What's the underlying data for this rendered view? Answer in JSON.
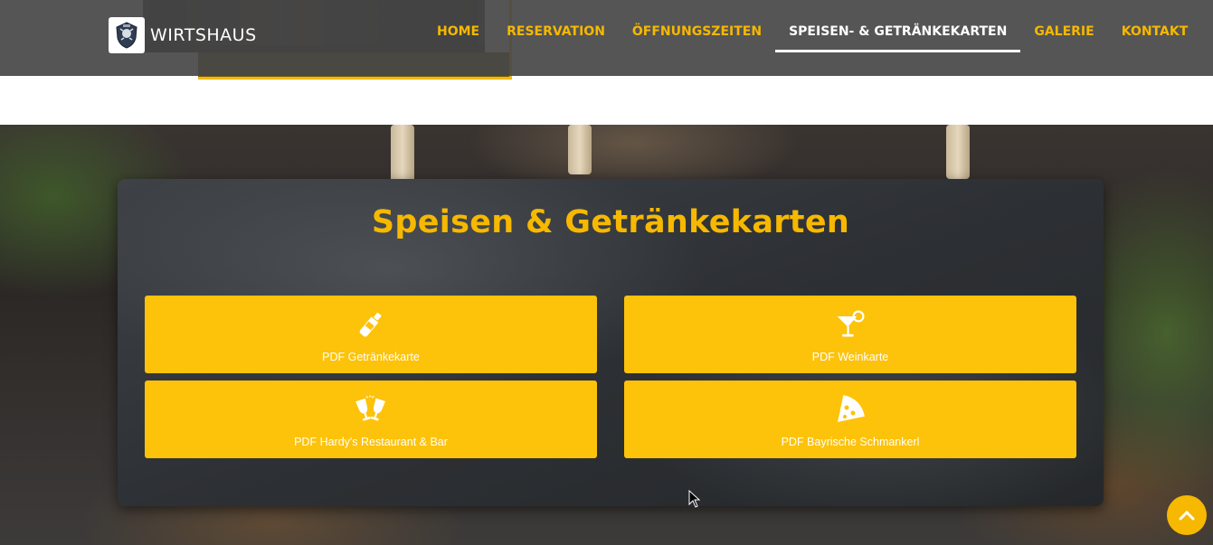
{
  "brand": {
    "name": "WIRTSHAUS",
    "logo_icon": "crest-icon"
  },
  "nav": {
    "items": [
      {
        "label": "HOME",
        "active": false
      },
      {
        "label": "RESERVATION",
        "active": false
      },
      {
        "label": "ÖFFNUNGSZEITEN",
        "active": false
      },
      {
        "label": "SPEISEN- & GETRÄNKEKARTEN",
        "active": true
      },
      {
        "label": "GALERIE",
        "active": false
      },
      {
        "label": "KONTAKT",
        "active": false
      }
    ]
  },
  "section": {
    "title": "Speisen & Getränkekarten",
    "cards": [
      {
        "label": "PDF Getränkekarte",
        "icon": "bottle-icon"
      },
      {
        "label": "PDF Weinkarte",
        "icon": "cocktail-icon"
      },
      {
        "label": "PDF Hardy's Restaurant & Bar",
        "icon": "cheers-glasses-icon"
      },
      {
        "label": "PDF Bayrische Schmankerl",
        "icon": "pizza-slice-icon"
      }
    ]
  },
  "colors": {
    "accent": "#f6b800",
    "card": "#fdc20a",
    "navbar": "#464646"
  },
  "scroll_top_icon": "chevron-up-icon"
}
